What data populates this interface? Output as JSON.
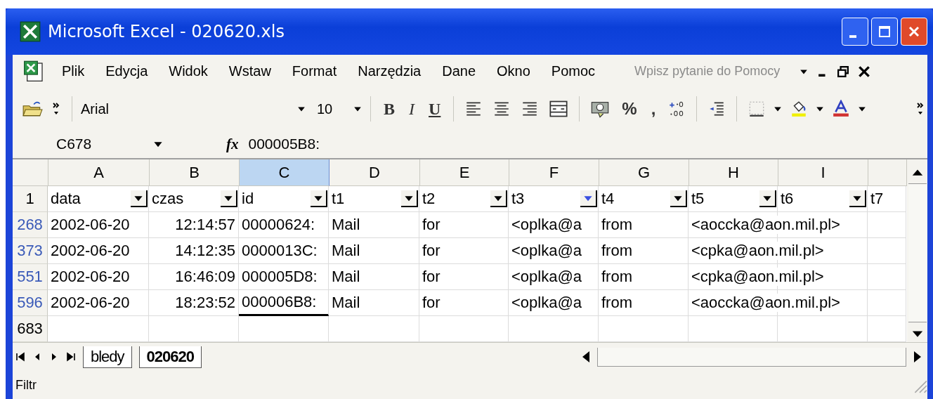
{
  "window": {
    "title": "Microsoft Excel - 020620.xls"
  },
  "menu": {
    "items": [
      "Plik",
      "Edycja",
      "Widok",
      "Wstaw",
      "Format",
      "Narzędzia",
      "Dane",
      "Okno",
      "Pomoc"
    ],
    "help_search": {
      "placeholder": "Wpisz pytanie do Pomocy"
    }
  },
  "toolbar": {
    "font": "Arial",
    "size": "10",
    "bold": "B",
    "italic": "I",
    "underline": "U",
    "percent": "%",
    "comma": ","
  },
  "formula_bar": {
    "name_box": "C678",
    "fx_label": "fx",
    "value": "000005B8:"
  },
  "columns": [
    {
      "letter": "A",
      "field": "data",
      "filter_active": false,
      "selected": false
    },
    {
      "letter": "B",
      "field": "czas",
      "filter_active": false,
      "selected": false
    },
    {
      "letter": "C",
      "field": "id",
      "filter_active": false,
      "selected": true
    },
    {
      "letter": "D",
      "field": "t1",
      "filter_active": false,
      "selected": false
    },
    {
      "letter": "E",
      "field": "t2",
      "filter_active": false,
      "selected": false
    },
    {
      "letter": "F",
      "field": "t3",
      "filter_active": true,
      "selected": false
    },
    {
      "letter": "G",
      "field": "t4",
      "filter_active": false,
      "selected": false
    },
    {
      "letter": "H",
      "field": "t5",
      "filter_active": false,
      "selected": false
    },
    {
      "letter": "I",
      "field": "t6",
      "filter_active": false,
      "selected": false
    },
    {
      "field": "t7"
    }
  ],
  "header_row_number": "1",
  "rows": [
    {
      "number": "268",
      "filtered": true,
      "has_active_cell": false,
      "cells": [
        "2002-06-20",
        "12:14:57",
        "00000624:",
        "Mail",
        "for",
        "<oplka@a",
        "from",
        "<aoccka@aon.mil.pl>"
      ]
    },
    {
      "number": "373",
      "filtered": true,
      "has_active_cell": false,
      "cells": [
        "2002-06-20",
        "14:12:35",
        "0000013C:",
        "Mail",
        "for",
        "<oplka@a",
        "from",
        "<cpka@aon.mil.pl>"
      ]
    },
    {
      "number": "551",
      "filtered": true,
      "has_active_cell": false,
      "cells": [
        "2002-06-20",
        "16:46:09",
        "000005D8:",
        "Mail",
        "for",
        "<oplka@a",
        "from",
        "<cpka@aon.mil.pl>"
      ]
    },
    {
      "number": "596",
      "filtered": true,
      "has_active_cell": true,
      "cells": [
        "2002-06-20",
        "18:23:52",
        "000006B8:",
        "Mail",
        "for",
        "<oplka@a",
        "from",
        "<aoccka@aon.mil.pl>"
      ]
    },
    {
      "number": "683",
      "filtered": false,
      "has_active_cell": false,
      "cells": []
    }
  ],
  "sheet_tabs": [
    {
      "label": "bledy",
      "selected": false
    },
    {
      "label": "020620",
      "selected": true
    }
  ],
  "status_bar": {
    "text": "Filtr"
  }
}
